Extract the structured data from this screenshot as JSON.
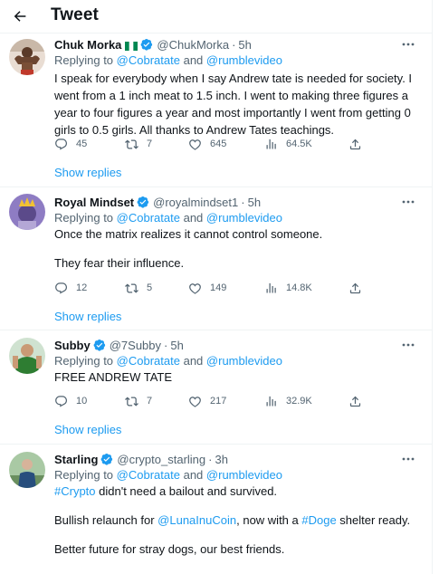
{
  "header": {
    "title": "Tweet"
  },
  "replies": [
    {
      "name": "Chuk Morka",
      "flag": "nigeria-flag",
      "handle": "@ChukMorka",
      "time": "5h",
      "replying_prefix": "Replying to",
      "mention1": "@Cobratate",
      "and": "and",
      "mention2": "@rumblevideo",
      "text": "I speak for everybody when I say Andrew tate is needed for society. I went from a 1 inch meat to 1.5 inch. I went to making three figures a year to four figures a year and most importantly I went from getting 0 girls to 0.5 girls. All thanks to Andrew Tates teachings.",
      "replies": "45",
      "retweets": "7",
      "likes": "645",
      "views": "64.5K",
      "show_replies": "Show replies"
    },
    {
      "name": "Royal Mindset",
      "handle": "@royalmindset1",
      "time": "5h",
      "replying_prefix": "Replying to",
      "mention1": "@Cobratate",
      "and": "and",
      "mention2": "@rumblevideo",
      "text1": "Once the matrix realizes it cannot control someone.",
      "text2": "They fear their influence.",
      "replies": "12",
      "retweets": "5",
      "likes": "149",
      "views": "14.8K",
      "show_replies": "Show replies"
    },
    {
      "name": "Subby",
      "handle": "@7Subby",
      "time": "5h",
      "replying_prefix": "Replying to",
      "mention1": "@Cobratate",
      "and": "and",
      "mention2": "@rumblevideo",
      "text": "FREE ANDREW TATE",
      "replies": "10",
      "retweets": "7",
      "likes": "217",
      "views": "32.9K",
      "show_replies": "Show replies"
    },
    {
      "name": "Starling",
      "handle": "@crypto_starling",
      "time": "3h",
      "replying_prefix": "Replying to",
      "mention1": "@Cobratate",
      "and": "and",
      "mention2": "@rumblevideo",
      "hashtag1": "#Crypto",
      "text1_rest": " didn't need a bailout and survived.",
      "text2_a": "Bullish relaunch for ",
      "mention3": "@LunaInuCoin",
      "text2_b": ", now with a ",
      "hashtag2": "#Doge",
      "text2_c": " shelter ready.",
      "text3": "Better future for stray dogs, our best friends."
    }
  ],
  "colors": {
    "accent": "#1d9bf0",
    "muted": "#536471",
    "text": "#0f1419",
    "divider": "#eff3f4"
  }
}
